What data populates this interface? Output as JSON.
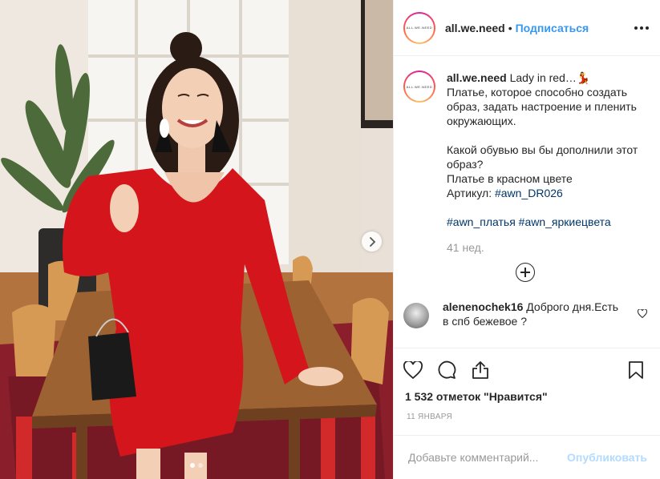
{
  "photo": {
    "alt": "",
    "dots": 2,
    "active_dot": 0
  },
  "header": {
    "username": "all.we.need",
    "separator": "•",
    "follow_label": "Подписаться",
    "avatar_text": "ALL.WE.NEED"
  },
  "caption": {
    "username": "all.we.need",
    "lines": [
      "Lady in red…💃",
      "Платье, которое способно создать",
      "образ, задать настроение и пленить",
      "окружающих.",
      "",
      "Какой обувью вы бы дополнили этот",
      "образ?",
      "Платье в красном цвете",
      "Артикул: "
    ],
    "article_tag": "#awn_DR026",
    "hashtags": "#awn_платья #awn_яркиецвета",
    "time_ago": "41 нед."
  },
  "comment": {
    "username": "alenenochek16",
    "text": "Доброго дня.Есть в спб бежевое ?"
  },
  "actions": {
    "likes": "1 532 отметок \"Нравится\"",
    "date": "11 ЯНВАРЯ"
  },
  "add_comment": {
    "placeholder": "Добавьте комментарий...",
    "publish_label": "Опубликовать"
  },
  "colors": {
    "accent": "#3897f0",
    "hashtag": "#003569",
    "dress": "#d4161c",
    "publish_disabled": "#b3dbff"
  }
}
